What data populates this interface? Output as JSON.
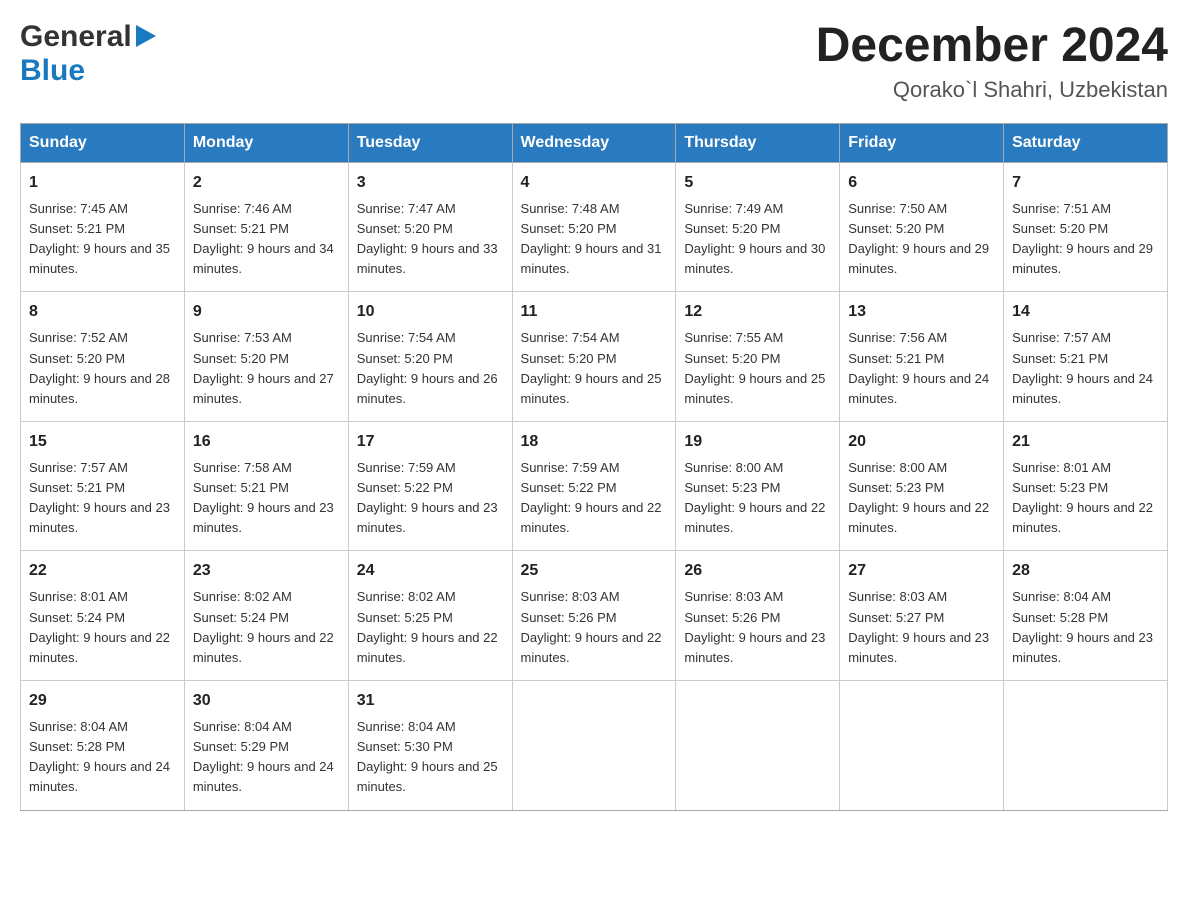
{
  "logo": {
    "general": "General",
    "blue": "Blue"
  },
  "header": {
    "month": "December 2024",
    "location": "Qorako`l Shahri, Uzbekistan"
  },
  "weekdays": [
    "Sunday",
    "Monday",
    "Tuesday",
    "Wednesday",
    "Thursday",
    "Friday",
    "Saturday"
  ],
  "weeks": [
    [
      {
        "day": "1",
        "sunrise": "7:45 AM",
        "sunset": "5:21 PM",
        "daylight": "9 hours and 35 minutes."
      },
      {
        "day": "2",
        "sunrise": "7:46 AM",
        "sunset": "5:21 PM",
        "daylight": "9 hours and 34 minutes."
      },
      {
        "day": "3",
        "sunrise": "7:47 AM",
        "sunset": "5:20 PM",
        "daylight": "9 hours and 33 minutes."
      },
      {
        "day": "4",
        "sunrise": "7:48 AM",
        "sunset": "5:20 PM",
        "daylight": "9 hours and 31 minutes."
      },
      {
        "day": "5",
        "sunrise": "7:49 AM",
        "sunset": "5:20 PM",
        "daylight": "9 hours and 30 minutes."
      },
      {
        "day": "6",
        "sunrise": "7:50 AM",
        "sunset": "5:20 PM",
        "daylight": "9 hours and 29 minutes."
      },
      {
        "day": "7",
        "sunrise": "7:51 AM",
        "sunset": "5:20 PM",
        "daylight": "9 hours and 29 minutes."
      }
    ],
    [
      {
        "day": "8",
        "sunrise": "7:52 AM",
        "sunset": "5:20 PM",
        "daylight": "9 hours and 28 minutes."
      },
      {
        "day": "9",
        "sunrise": "7:53 AM",
        "sunset": "5:20 PM",
        "daylight": "9 hours and 27 minutes."
      },
      {
        "day": "10",
        "sunrise": "7:54 AM",
        "sunset": "5:20 PM",
        "daylight": "9 hours and 26 minutes."
      },
      {
        "day": "11",
        "sunrise": "7:54 AM",
        "sunset": "5:20 PM",
        "daylight": "9 hours and 25 minutes."
      },
      {
        "day": "12",
        "sunrise": "7:55 AM",
        "sunset": "5:20 PM",
        "daylight": "9 hours and 25 minutes."
      },
      {
        "day": "13",
        "sunrise": "7:56 AM",
        "sunset": "5:21 PM",
        "daylight": "9 hours and 24 minutes."
      },
      {
        "day": "14",
        "sunrise": "7:57 AM",
        "sunset": "5:21 PM",
        "daylight": "9 hours and 24 minutes."
      }
    ],
    [
      {
        "day": "15",
        "sunrise": "7:57 AM",
        "sunset": "5:21 PM",
        "daylight": "9 hours and 23 minutes."
      },
      {
        "day": "16",
        "sunrise": "7:58 AM",
        "sunset": "5:21 PM",
        "daylight": "9 hours and 23 minutes."
      },
      {
        "day": "17",
        "sunrise": "7:59 AM",
        "sunset": "5:22 PM",
        "daylight": "9 hours and 23 minutes."
      },
      {
        "day": "18",
        "sunrise": "7:59 AM",
        "sunset": "5:22 PM",
        "daylight": "9 hours and 22 minutes."
      },
      {
        "day": "19",
        "sunrise": "8:00 AM",
        "sunset": "5:23 PM",
        "daylight": "9 hours and 22 minutes."
      },
      {
        "day": "20",
        "sunrise": "8:00 AM",
        "sunset": "5:23 PM",
        "daylight": "9 hours and 22 minutes."
      },
      {
        "day": "21",
        "sunrise": "8:01 AM",
        "sunset": "5:23 PM",
        "daylight": "9 hours and 22 minutes."
      }
    ],
    [
      {
        "day": "22",
        "sunrise": "8:01 AM",
        "sunset": "5:24 PM",
        "daylight": "9 hours and 22 minutes."
      },
      {
        "day": "23",
        "sunrise": "8:02 AM",
        "sunset": "5:24 PM",
        "daylight": "9 hours and 22 minutes."
      },
      {
        "day": "24",
        "sunrise": "8:02 AM",
        "sunset": "5:25 PM",
        "daylight": "9 hours and 22 minutes."
      },
      {
        "day": "25",
        "sunrise": "8:03 AM",
        "sunset": "5:26 PM",
        "daylight": "9 hours and 22 minutes."
      },
      {
        "day": "26",
        "sunrise": "8:03 AM",
        "sunset": "5:26 PM",
        "daylight": "9 hours and 23 minutes."
      },
      {
        "day": "27",
        "sunrise": "8:03 AM",
        "sunset": "5:27 PM",
        "daylight": "9 hours and 23 minutes."
      },
      {
        "day": "28",
        "sunrise": "8:04 AM",
        "sunset": "5:28 PM",
        "daylight": "9 hours and 23 minutes."
      }
    ],
    [
      {
        "day": "29",
        "sunrise": "8:04 AM",
        "sunset": "5:28 PM",
        "daylight": "9 hours and 24 minutes."
      },
      {
        "day": "30",
        "sunrise": "8:04 AM",
        "sunset": "5:29 PM",
        "daylight": "9 hours and 24 minutes."
      },
      {
        "day": "31",
        "sunrise": "8:04 AM",
        "sunset": "5:30 PM",
        "daylight": "9 hours and 25 minutes."
      },
      null,
      null,
      null,
      null
    ]
  ]
}
